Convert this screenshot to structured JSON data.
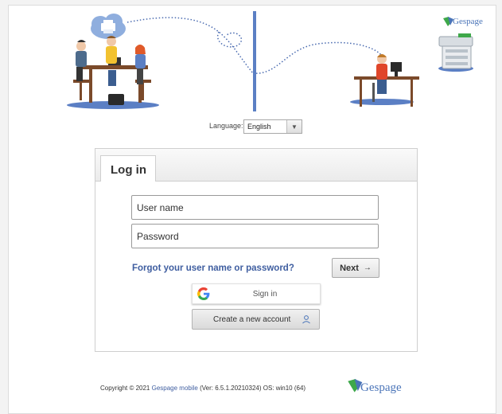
{
  "brand": {
    "name": "Gespage"
  },
  "language": {
    "label": "Language:",
    "selected": "English"
  },
  "login": {
    "tab_label": "Log in",
    "username_placeholder": "User name",
    "password_placeholder": "Password",
    "forgot_link": "Forgot your user name or password?",
    "next_label": "Next",
    "next_icon": "arrow-right-icon",
    "google_label": "Sign in",
    "create_account_label": "Create a new account",
    "create_account_icon": "user-icon"
  },
  "footer": {
    "prefix": "Copyright © 2021",
    "link": "Gespage mobile",
    "suffix": "(Ver: 6.5.1.20210324) OS: win10 (64)"
  },
  "colors": {
    "accent": "#3f5ea0",
    "logo_blue": "#4a74b8",
    "logo_green": "#3ea84a",
    "divider_blue": "#5b7fc4"
  }
}
